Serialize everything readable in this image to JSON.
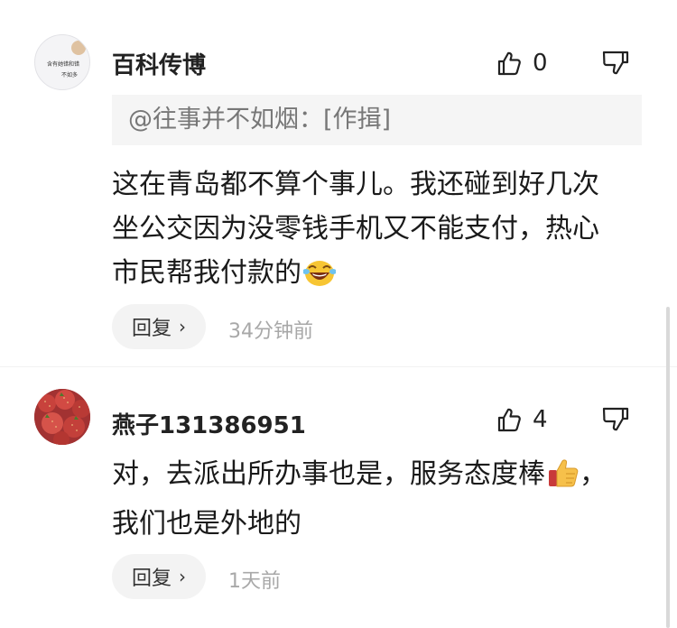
{
  "comments": [
    {
      "username": "百科传博",
      "avatar_text_1": "含有她错和错",
      "avatar_text_2": "不如多",
      "likes": "0",
      "quote": "@往事并不如烟：[作揖]",
      "body_lines": [
        "这在青岛都不算个事儿。我还碰到好几次",
        "坐公交因为没零钱手机又不能支付，热心",
        "市民帮我付款的"
      ],
      "body_emoji": "laughing-crying-emoji",
      "reply_label": "回复",
      "time": "34分钟前"
    },
    {
      "username": "燕子131386951",
      "likes": "4",
      "body_lines": [
        "对，去派出所办事也是，服务态度棒",
        "我们也是外地的"
      ],
      "body_emoji": "thumbs-up-emoji",
      "body_after_emoji": "，",
      "reply_label": "回复",
      "time": "1天前"
    }
  ],
  "icons": {
    "like": "thumbs-up-outline-icon",
    "dislike": "thumbs-down-outline-icon",
    "chevron": "chevron-right-icon"
  }
}
